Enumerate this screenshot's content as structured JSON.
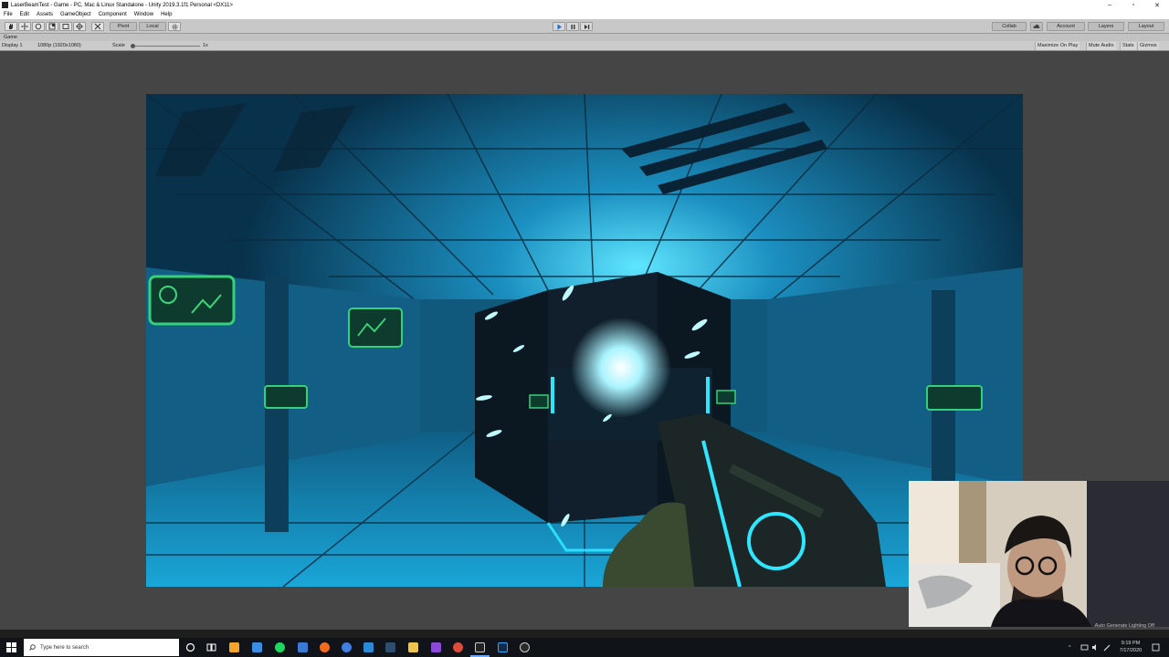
{
  "window": {
    "title": "LaserBeamTest - Game - PC, Mac & Linux Standalone - Unity 2019.3.1f1 Personal <DX11>",
    "minimize_glyph": "–",
    "maximize_glyph": "▫",
    "close_glyph": "✕"
  },
  "menu": [
    "File",
    "Edit",
    "Assets",
    "GameObject",
    "Component",
    "Window",
    "Help"
  ],
  "toolbar": {
    "tools": [
      "hand-icon",
      "move-icon",
      "rotate-icon",
      "scale-icon",
      "rect-icon",
      "transform-icon"
    ],
    "pivot_label": "Pivot",
    "local_label": "Local",
    "play_state": "playing",
    "collab_label": "Collab",
    "account_label": "Account",
    "layers_label": "Layers",
    "layout_label": "Layout"
  },
  "game_tab": {
    "label": "Game"
  },
  "game_bar": {
    "display_label": "Display 1",
    "resolution_label": "1080p (1920x1080)",
    "scale_label": "Scale",
    "scale_value": "1x",
    "maximize_on_play": "Maximize On Play",
    "mute_audio": "Mute Audio",
    "stats": "Stats",
    "gizmos": "Gizmos"
  },
  "status": {
    "autogen_lighting": "Auto Generate Lighting Off"
  },
  "taskbar": {
    "search_placeholder": "Type here to search",
    "time": "9:19 PM",
    "date": "7/17/2020",
    "apps": [
      "cortana-icon",
      "task-view-icon",
      "folder-icon",
      "document-icon",
      "spotify-icon",
      "app-icon",
      "vpn-icon",
      "chrome-icon",
      "app2-icon",
      "steam-icon",
      "explorer-icon",
      "visual-studio-icon",
      "chrome-icon",
      "unity-icon",
      "photoshop-icon",
      "obs-icon"
    ]
  },
  "colors": {
    "editor_bg": "#454545",
    "toolbar_bg": "#c8c8c8",
    "game_cyan": "#2ee6ff",
    "panel_green": "#3dd67a",
    "taskbar_bg": "#101318"
  }
}
